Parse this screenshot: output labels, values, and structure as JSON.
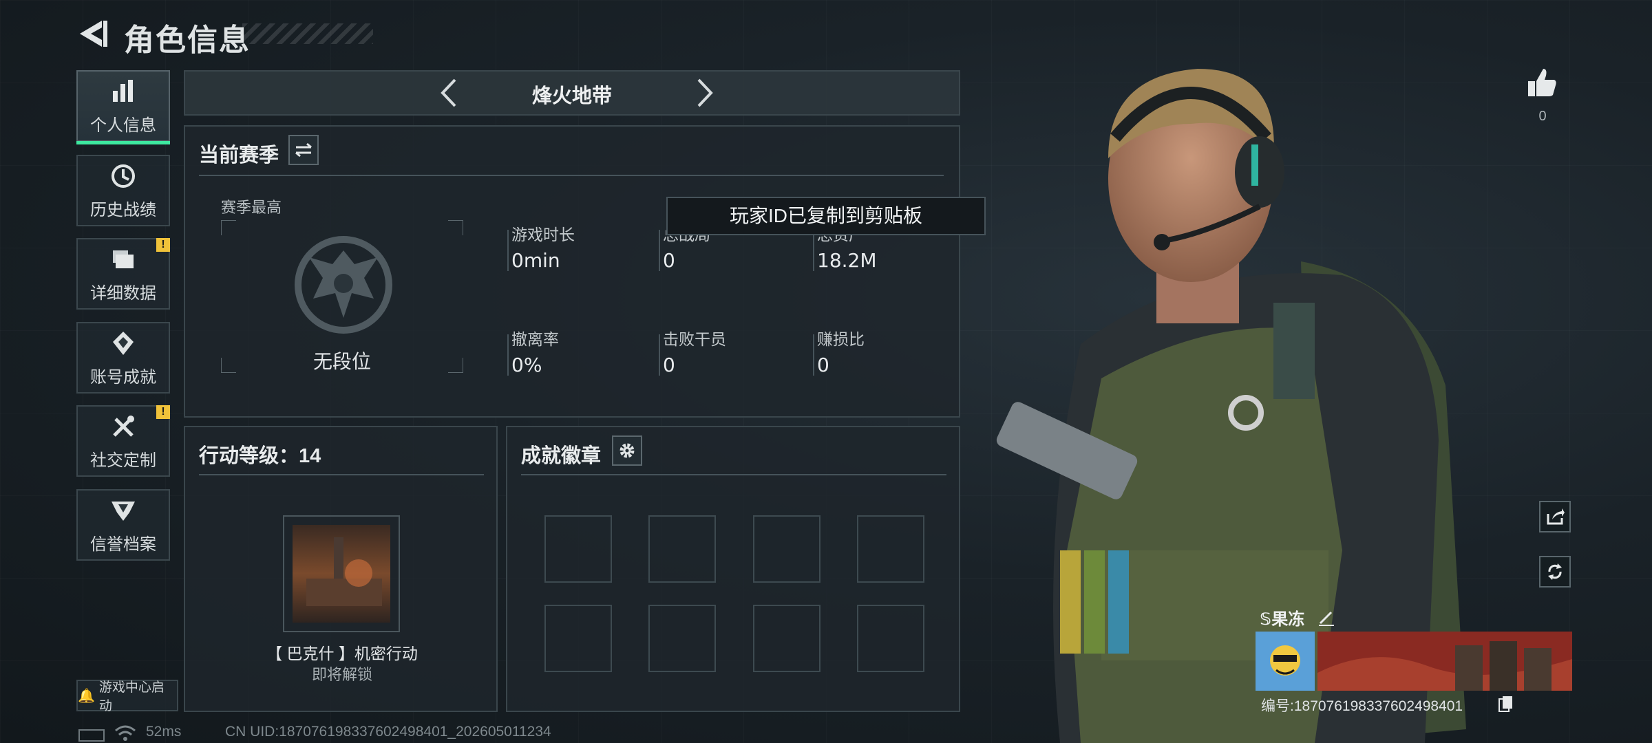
{
  "header": {
    "title": "角色信息"
  },
  "nav": {
    "items": [
      {
        "label": "个人信息",
        "icon": "bar-chart-icon",
        "active": true,
        "alert": false
      },
      {
        "label": "历史战绩",
        "icon": "history-clock-icon",
        "active": false,
        "alert": false
      },
      {
        "label": "详细数据",
        "icon": "folder-icon",
        "active": false,
        "alert": true
      },
      {
        "label": "账号成就",
        "icon": "achievement-diamond-icon",
        "active": false,
        "alert": false
      },
      {
        "label": "社交定制",
        "icon": "tools-icon",
        "active": false,
        "alert": true
      },
      {
        "label": "信誉档案",
        "icon": "shield-rank-icon",
        "active": false,
        "alert": false
      }
    ],
    "badge_mark": "!",
    "game_center_label": "游戏中心启动"
  },
  "mode": {
    "title": "烽火地带"
  },
  "season": {
    "title": "当前赛季",
    "best_label": "赛季最高",
    "rank_name": "无段位",
    "stats": [
      {
        "label": "游戏时长",
        "value": "0min"
      },
      {
        "label": "总战局",
        "value": "0"
      },
      {
        "label": "总资产",
        "value": "18.2M"
      },
      {
        "label": "撤离率",
        "value": "0%"
      },
      {
        "label": "击败干员",
        "value": "0"
      },
      {
        "label": "赚损比",
        "value": "0"
      }
    ]
  },
  "toast": {
    "text": "玩家ID已复制到剪贴板"
  },
  "level": {
    "title": "行动等级：14",
    "mission_name": "【 巴克什 】机密行动",
    "mission_status": "即将解锁"
  },
  "badges": {
    "title": "成就徽章",
    "slot_count": 8
  },
  "status": {
    "ping": "52ms",
    "uid": "CN UID:187076198337602498401_202605011234"
  },
  "profile": {
    "likes": "0",
    "name": "果冻",
    "name_prefix": "𝕊",
    "id_label": "编号:187076198337602498401"
  },
  "colors": {
    "accent": "#3ee8a0",
    "alert": "#f0c23a",
    "panel_border": "#3a464c"
  }
}
